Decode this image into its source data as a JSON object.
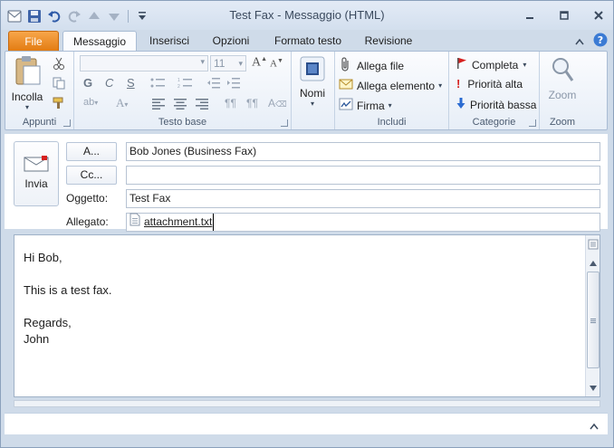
{
  "window": {
    "title": "Test Fax  -  Messaggio (HTML)"
  },
  "tabs": [
    "File",
    "Messaggio",
    "Inserisci",
    "Opzioni",
    "Formato testo",
    "Revisione"
  ],
  "ribbon": {
    "groups": {
      "appunti": "Appunti",
      "testo_base": "Testo base",
      "nomi": "Nomi",
      "includi": "Includi",
      "categorie": "Categorie",
      "zoom": "Zoom"
    },
    "incolla": "Incolla",
    "font_size": "11",
    "nomi_label": "Nomi",
    "allega_file": "Allega file",
    "allega_elemento": "Allega elemento",
    "firma": "Firma",
    "completa": "Completa",
    "priorita_alta": "Priorità alta",
    "priorita_bassa": "Priorità bassa",
    "zoom_label": "Zoom",
    "bold": "G",
    "italic": "C",
    "underline": "S"
  },
  "compose": {
    "send_label": "Invia",
    "to_button": "A...",
    "cc_button": "Cc...",
    "to_value": "Bob Jones (Business Fax)",
    "cc_value": "",
    "subject_label": "Oggetto:",
    "subject_value": "Test Fax",
    "attachment_label": "Allegato:",
    "attachment_name": "attachment.txt"
  },
  "body": {
    "lines": [
      "Hi Bob,",
      "",
      "This is a test fax.",
      "",
      "Regards,",
      "John"
    ]
  },
  "colors": {
    "file_tab": "#e27a10",
    "ribbon_bg": "#fbfcfe",
    "accent_blue": "#2b579a",
    "high_priority": "#d6201f",
    "low_priority": "#2a6bd1"
  }
}
